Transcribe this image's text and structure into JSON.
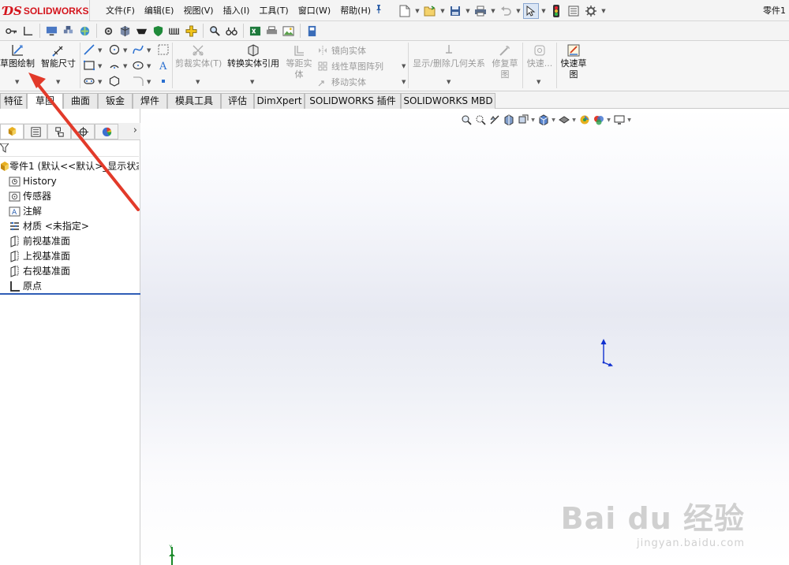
{
  "app": {
    "brand": "SOLIDWORKS",
    "document_title": "零件1",
    "accent_color": "#d4151d"
  },
  "menu": {
    "items": [
      "文件(F)",
      "编辑(E)",
      "视图(V)",
      "插入(I)",
      "工具(T)",
      "窗口(W)",
      "帮助(H)"
    ]
  },
  "command_manager": {
    "sketch_button": "草图绘制",
    "smart_dimension": "智能尺寸",
    "trim_entities": "剪裁实体(T)",
    "convert_entities": "转换实体引用",
    "offset_entities": [
      "等距实",
      "体"
    ],
    "mirror_entities": "镜向实体",
    "linear_pattern": "线性草图阵列",
    "move_entities": "移动实体",
    "display_relations": "显示/删除几何关系",
    "repair_sketch": [
      "修复草",
      "图"
    ],
    "quick_snaps": "快速...",
    "rapid_sketch": [
      "快速草",
      "图"
    ]
  },
  "tabs": [
    {
      "label": "特征",
      "active": false
    },
    {
      "label": "草图",
      "active": true
    },
    {
      "label": "曲面",
      "active": false
    },
    {
      "label": "钣金",
      "active": false
    },
    {
      "label": "焊件",
      "active": false
    },
    {
      "label": "模具工具",
      "active": false
    },
    {
      "label": "评估",
      "active": false
    },
    {
      "label": "DimXpert",
      "active": false
    },
    {
      "label": "SOLIDWORKS 插件",
      "active": false
    },
    {
      "label": "SOLIDWORKS MBD",
      "active": false
    }
  ],
  "feature_tree": {
    "root": "零件1 (默认<<默认>_显示状态",
    "items": [
      "History",
      "传感器",
      "注解",
      "材质 <未指定>",
      "前视基准面",
      "上视基准面",
      "右视基准面",
      "原点"
    ]
  },
  "watermark": {
    "main": "Bai du 经验",
    "sub": "jingyan.baidu.com"
  }
}
